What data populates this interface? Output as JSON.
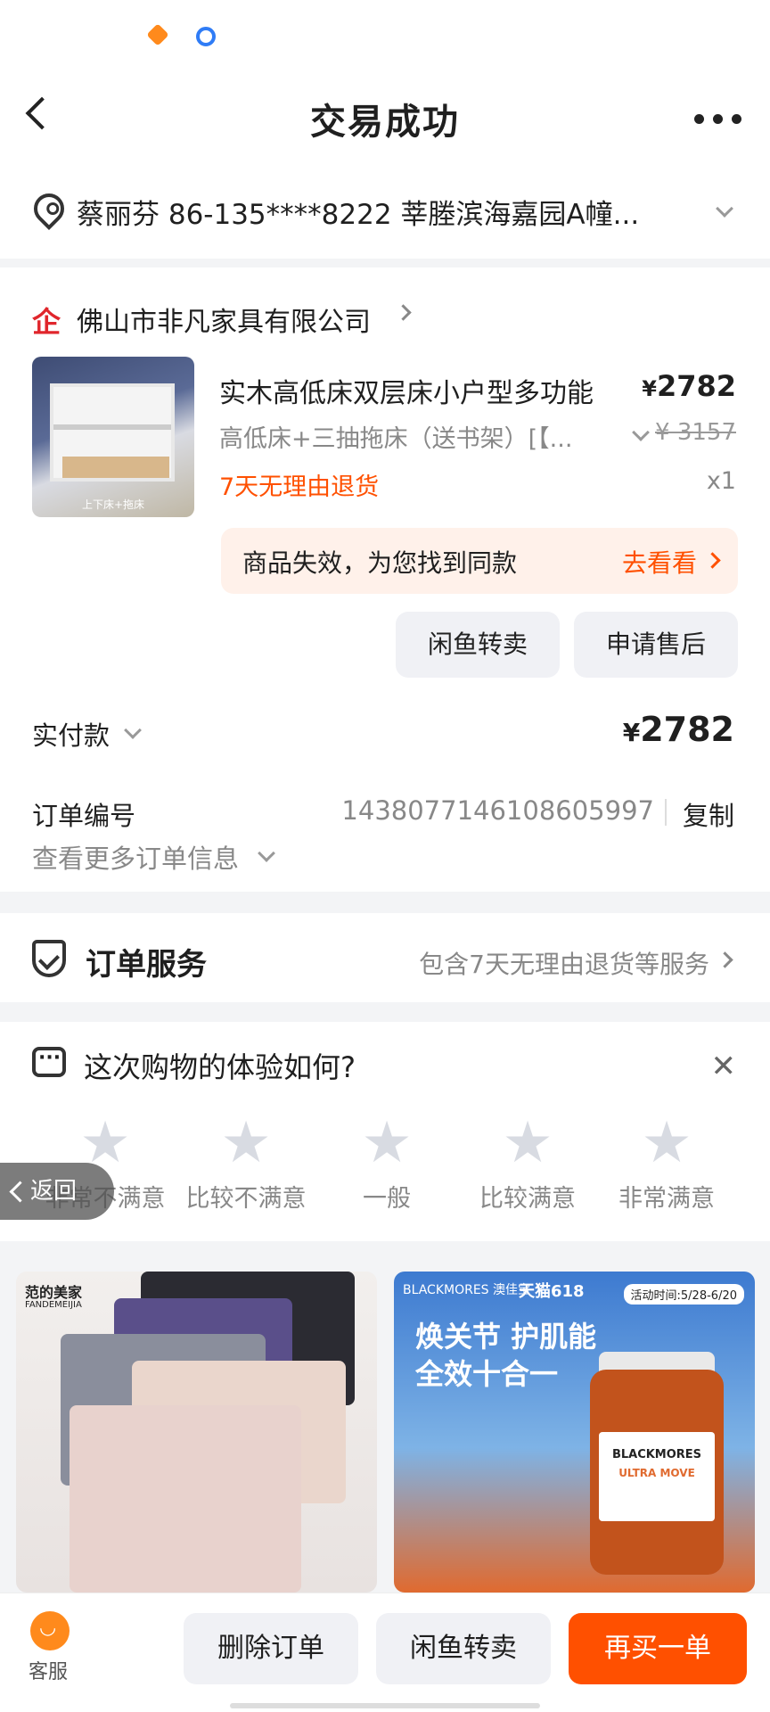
{
  "header": {
    "title": "交易成功"
  },
  "address": {
    "text": "蔡丽芬 86-135****8222 莘塍滨海嘉园A幢..."
  },
  "shop": {
    "name": "佛山市非凡家具有限公司",
    "icon": "企"
  },
  "product": {
    "image_caption": "上下床+拖床",
    "title": "实木高低床双层床小户型多功能",
    "price": "2782",
    "currency": "¥",
    "sku": "高低床+三抽拖床（送书架）[【...",
    "original_price": "¥ 3157",
    "refund_tag": "7天无理由退货",
    "quantity": "x1"
  },
  "invalid_notice": {
    "text": "商品失效，为您找到同款",
    "link": "去看看"
  },
  "item_actions": {
    "resell": "闲鱼转卖",
    "after_sale": "申请售后"
  },
  "payment": {
    "label": "实付款",
    "currency": "¥",
    "amount": "2782"
  },
  "order": {
    "label": "订单编号",
    "number": "1438077146108605997",
    "copy": "复制",
    "more": "查看更多订单信息"
  },
  "service": {
    "title": "订单服务",
    "desc": "包含7天无理由退货等服务"
  },
  "feedback": {
    "title": "这次购物的体验如何?",
    "close": "✕",
    "ratings": [
      "非常不满意",
      "比较不满意",
      "一般",
      "比较满意",
      "非常满意"
    ]
  },
  "float_back": {
    "label": "返回"
  },
  "recommend": [
    {
      "brand": "范的美家",
      "brand_en": "FANDEMEIJIA"
    },
    {
      "top": "BLACKMORES 澳佳宝 ×",
      "tmall": "天猫618",
      "date": "活动时间:5/28-6/20",
      "headline1": "焕关节 护肌能",
      "headline2": "全效十合一",
      "bottle_brand": "BLACKMORES",
      "bottle_sub": "ULTRA MOVE"
    }
  ],
  "bottom_bar": {
    "cs_label": "客服",
    "delete": "删除订单",
    "resell": "闲鱼转卖",
    "rebuy": "再买一单"
  },
  "colors": {
    "accent": "#ff5000",
    "shop_red": "#e0262c"
  }
}
